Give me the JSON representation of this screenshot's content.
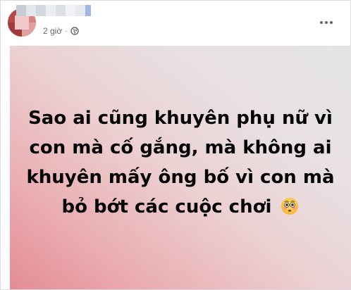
{
  "post": {
    "time_label": "2 giờ",
    "separator": "·",
    "status_text": "Sao ai cũng khuyên phụ nữ vì con mà cố gắng, mà không ai khuyên mấy ông bố vì con mà bỏ bớt các cuộc chơi",
    "emoji": "flushed-face-icon",
    "privacy_icon": "public-globe-icon",
    "menu_icon": "more-options-icon"
  },
  "colors": {
    "background_gradient_start": "#e38c92",
    "background_gradient_end": "#e4e4e6",
    "text": "#050505",
    "meta_text": "#65676b"
  }
}
